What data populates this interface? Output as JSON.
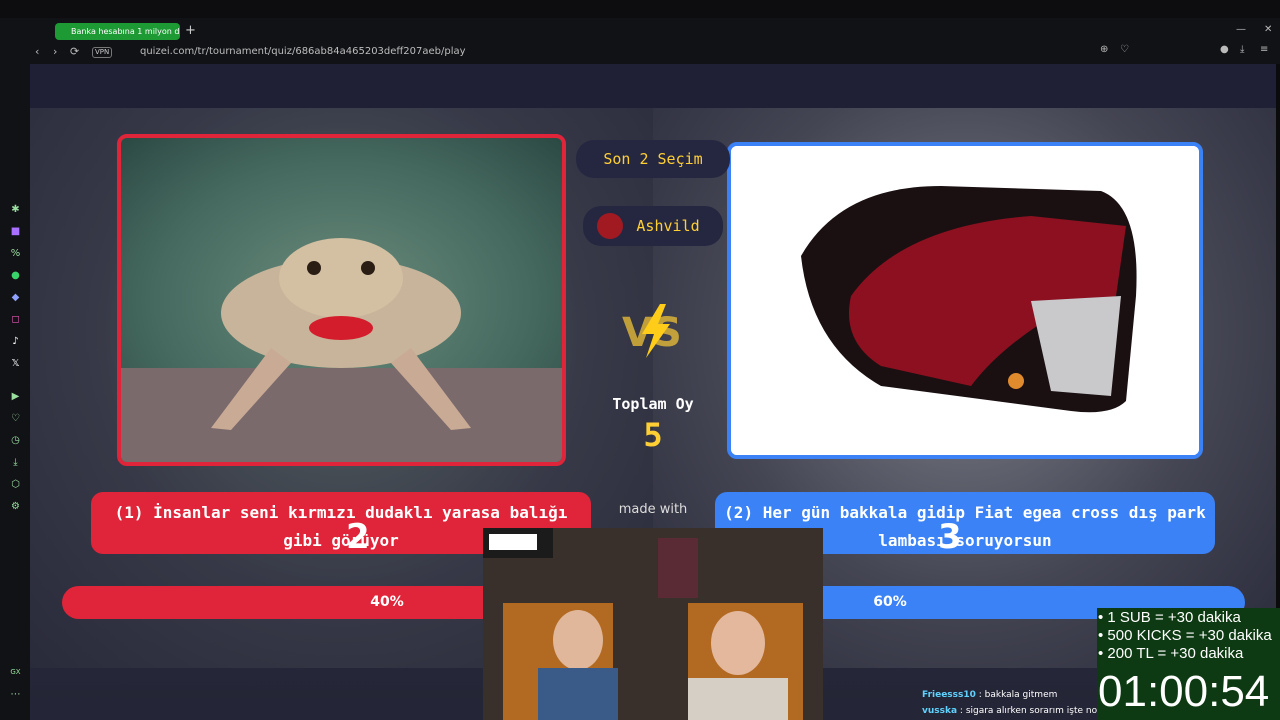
{
  "browser": {
    "tab_title": "Banka hesabına 1 milyon d",
    "tab_add": "+",
    "vpn": "VPN",
    "url": "quizei.com/tr/tournament/quiz/686ab84a465203deff207aeb/play"
  },
  "quiz": {
    "round_label": "Son 2 Seçim",
    "user": "Ashvild",
    "total_label": "Toplam Oy",
    "total_votes": "5",
    "made_with": "made with",
    "left": {
      "answer": "(1) İnsanlar seni kırmızı dudaklı yarasa balığı gibi görüyor",
      "percent": "40%",
      "fraction": 0.4,
      "number": "2"
    },
    "right": {
      "answer": "(2) Her gün bakkala gidip Fiat egea cross dış park lambası soruyorsun",
      "percent": "60%",
      "fraction": 0.6,
      "number": "3"
    }
  },
  "overlay": {
    "sub_rules": [
      "• 1 SUB = +30 dakika",
      "• 500 KICKS = +30 dakika",
      "• 200 TL = +30 dakika"
    ],
    "timer": "01:00:54",
    "chat": [
      {
        "user": "Frieesss10",
        "message": ": bakkala gitmem"
      },
      {
        "user": "vusska",
        "message": ": sigara alırken sorarım işte noldu"
      }
    ]
  },
  "colors": {
    "left_accent": "#e0243a",
    "right_accent": "#3b82f6",
    "highlight": "#ffcf33"
  }
}
